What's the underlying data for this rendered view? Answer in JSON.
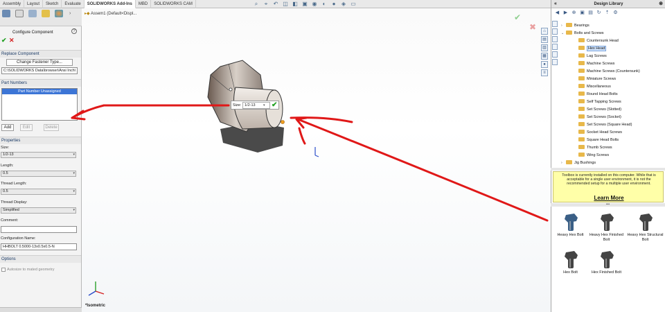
{
  "topbar": {
    "tabs": [
      "Assembly",
      "Layout",
      "Sketch",
      "Evaluate",
      "SOLIDWORKS Add-Ins",
      "MBD",
      "SOLIDWORKS CAM"
    ]
  },
  "left_panel": {
    "title": "Configure Component",
    "replace_section": "Replace Component",
    "change_button": "Change Fastener Type...",
    "path": "C:\\SOLIDWORKS Data\\browser\\Ansi Inch\\",
    "part_numbers_section": "Part Numbers",
    "part_number_item": "Part Number Unassigned",
    "add": "Add",
    "edit": "Edit",
    "delete": "Delete",
    "properties_section": "Properties",
    "size_label": "Size:",
    "size_value": "1/2-13",
    "length_label": "Length:",
    "length_value": "0.5",
    "thread_length_label": "Thread Length:",
    "thread_length_value": "0.5",
    "thread_display_label": "Thread Display:",
    "thread_display_value": "Simplified",
    "comment_label": "Comment:",
    "config_name_label": "Configuration Name:",
    "config_name_value": "HHBOLT 0.5000-13x0.5x0.5-N",
    "options_section": "Options",
    "options_check": "Autosize to mated geometry"
  },
  "viewport": {
    "tree_head": "Assem1 (Default<Displ...",
    "size_label": "Size:",
    "size_value": "1/2-13",
    "view_label": "*Isometric"
  },
  "library": {
    "title": "Design Library",
    "tree": [
      {
        "label": "Bearings",
        "level": 1,
        "toggle": "›"
      },
      {
        "label": "Bolts and Screws",
        "level": 1,
        "toggle": "⌄"
      },
      {
        "label": "Countersunk Head",
        "level": 2,
        "toggle": ""
      },
      {
        "label": "Hex Head",
        "level": 2,
        "toggle": "",
        "selected": true
      },
      {
        "label": "Lag Screws",
        "level": 2,
        "toggle": ""
      },
      {
        "label": "Machine Screws",
        "level": 2,
        "toggle": ""
      },
      {
        "label": "Machine Screws (Countersunk)",
        "level": 2,
        "toggle": ""
      },
      {
        "label": "Miniature Screws",
        "level": 2,
        "toggle": ""
      },
      {
        "label": "Miscellaneous",
        "level": 2,
        "toggle": ""
      },
      {
        "label": "Round Head Bolts",
        "level": 2,
        "toggle": ""
      },
      {
        "label": "Self Tapping Screws",
        "level": 2,
        "toggle": ""
      },
      {
        "label": "Set Screws (Slotted)",
        "level": 2,
        "toggle": ""
      },
      {
        "label": "Set Screws (Socket)",
        "level": 2,
        "toggle": ""
      },
      {
        "label": "Set Screws (Square Head)",
        "level": 2,
        "toggle": ""
      },
      {
        "label": "Socket Head Screws",
        "level": 2,
        "toggle": ""
      },
      {
        "label": "Square Head Bolts",
        "level": 2,
        "toggle": ""
      },
      {
        "label": "Thumb Screws",
        "level": 2,
        "toggle": ""
      },
      {
        "label": "Wing Screws",
        "level": 2,
        "toggle": ""
      },
      {
        "label": "Jig Bushings",
        "level": 1,
        "toggle": "›"
      }
    ],
    "notice": "Toolbox is currently installed on this computer. While that is acceptable for a single user environment, it is not the recommended setup for a multiple user environment.",
    "learn_more": "Learn More",
    "parts": [
      {
        "label": "Heavy Hex Bolt",
        "color": "#3a5f86"
      },
      {
        "label": "Heavy Hex Finished Bolt",
        "color": "#444444"
      },
      {
        "label": "Heavy Hex Structural Bolt",
        "color": "#444444"
      },
      {
        "label": "Hex Bolt",
        "color": "#444444"
      },
      {
        "label": "Hex Finished Bolt",
        "color": "#444444"
      }
    ]
  },
  "colors": {
    "annotation_red": "#e01818",
    "ok_green": "#21a021",
    "cancel_red": "#d42020",
    "selection_blue": "#3c75d6"
  }
}
